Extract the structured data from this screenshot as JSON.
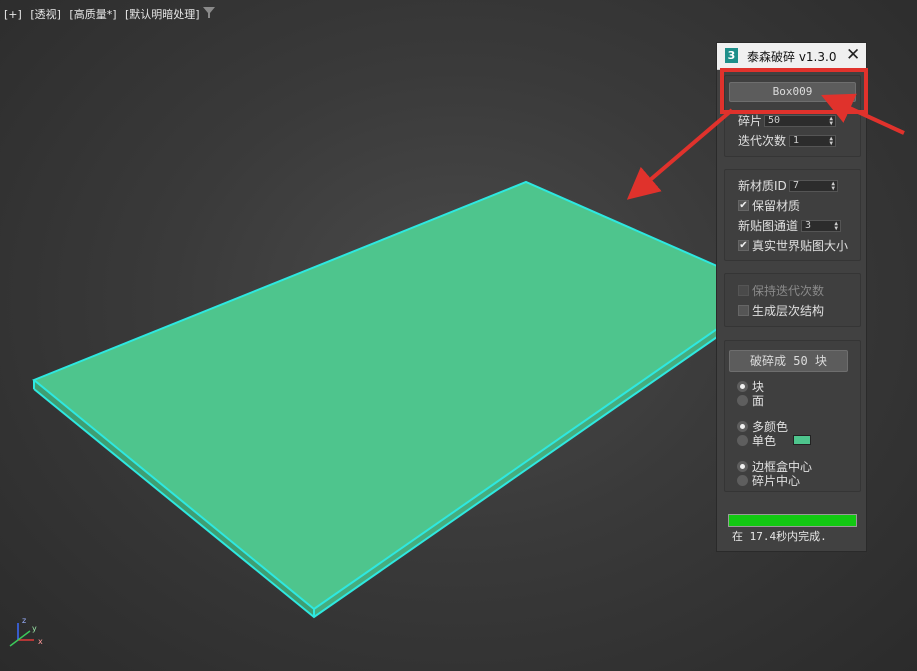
{
  "viewport": {
    "labels": [
      "[+]",
      "[透视]",
      "[高质量*]",
      "[默认明暗处理]"
    ],
    "icons": {
      "filter": "filter-icon",
      "axis": "axis-gizmo-icon"
    },
    "axis_labels": {
      "z": "z",
      "y": "y",
      "x": "x"
    },
    "colors": {
      "object_fill": "#4ec58d",
      "object_edge": "#2ee8e0"
    }
  },
  "dialog": {
    "app_icon": "3",
    "title": "泰森破碎 v1.3.0",
    "close_icon": "close-icon",
    "object_button": "Box009",
    "fragments_label": "碎片",
    "fragments_value": "50",
    "iterations_label": "迭代次数",
    "iterations_value": "1",
    "material_id_label": "新材质ID",
    "material_id_value": "7",
    "keep_material_label": "保留材质",
    "keep_material_checked": true,
    "map_channel_label": "新贴图通道",
    "map_channel_value": "3",
    "real_world_label": "真实世界贴图大小",
    "real_world_checked": true,
    "keep_iterations_label": "保持迭代次数",
    "keep_iterations_checked": false,
    "hierarchy_label": "生成层次结构",
    "hierarchy_checked": false,
    "break_button": "破碎成 50 块",
    "mode_options": [
      "块",
      "面"
    ],
    "mode_selected": "块",
    "color_options": [
      "多颜色",
      "单色"
    ],
    "color_selected": "多颜色",
    "single_color": "#4ec58d",
    "pivot_options": [
      "边框盒中心",
      "碎片中心"
    ],
    "pivot_selected": "边框盒中心",
    "progress": 1.0,
    "progress_color": "#12c912",
    "status": "在 17.4秒内完成."
  },
  "annotation": {
    "highlight_color": "#e0322c"
  }
}
